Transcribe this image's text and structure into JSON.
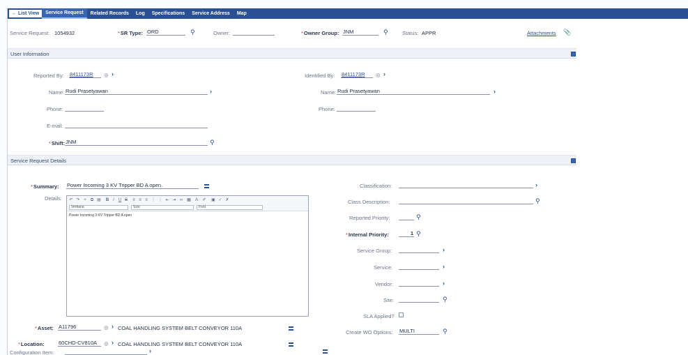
{
  "tabs": {
    "back": "← List View",
    "items": [
      "Service Request",
      "Related Records",
      "Log",
      "Specifications",
      "Service Address",
      "Map"
    ]
  },
  "header": {
    "sr_label": "Service Request:",
    "sr_value": "1054932",
    "sr_type_label": "SR Type:",
    "sr_type_value": "ORD",
    "owner_label": "Owner:",
    "owner_value": "",
    "owner_group_label": "Owner Group:",
    "owner_group_value": "JNM",
    "status_label": "Status:",
    "status_value": "APPR",
    "attachments": "Attachments"
  },
  "user_info": {
    "title": "User Information",
    "reported_by_label": "Reported By:",
    "reported_by_value": "8411173R",
    "name_label": "Name:",
    "name_value": "Rudi Prasetyawan",
    "phone_label": "Phone:",
    "email_label": "E-mail:",
    "shift_label": "Shift:",
    "shift_value": "JNM",
    "identified_by_label": "Identified By:",
    "identified_by_value": "8411173R",
    "id_name_label": "Name:",
    "id_name_value": "Rudi Prasetyawan",
    "id_phone_label": "Phone:"
  },
  "details": {
    "title": "Service Request Details",
    "summary_label": "Summary:",
    "summary_value": "Power Incoming 3 KV Tripper BD A open.",
    "details_label": "Details:",
    "details_text": "Power Incoming 3 KV Tripper BD A open",
    "font_size_label": "Size",
    "font_family_value": "Verdana",
    "format_value": "Font",
    "asset_label": "Asset:",
    "asset_value": "A11796",
    "asset_desc": "COAL HANDLING SYSTEM BELT CONVEYOR 110A",
    "location_label": "Location:",
    "location_value": "60CHD-CV810A",
    "location_desc": "COAL HANDLING SYSTEM BELT CONVEYOR 110A",
    "config_label": "Configuration Item:",
    "classification_label": "Classification:",
    "class_desc_label": "Class Description:",
    "reported_priority_label": "Reported Priority:",
    "internal_priority_label": "Internal Priority:",
    "internal_priority_value": "1",
    "service_group_label": "Service Group:",
    "service_label": "Service:",
    "vendor_label": "Vendor:",
    "site_label": "Site:",
    "sla_label": "SLA Applied?",
    "create_wo_label": "Create WO Options:",
    "create_wo_value": "MULTI"
  }
}
